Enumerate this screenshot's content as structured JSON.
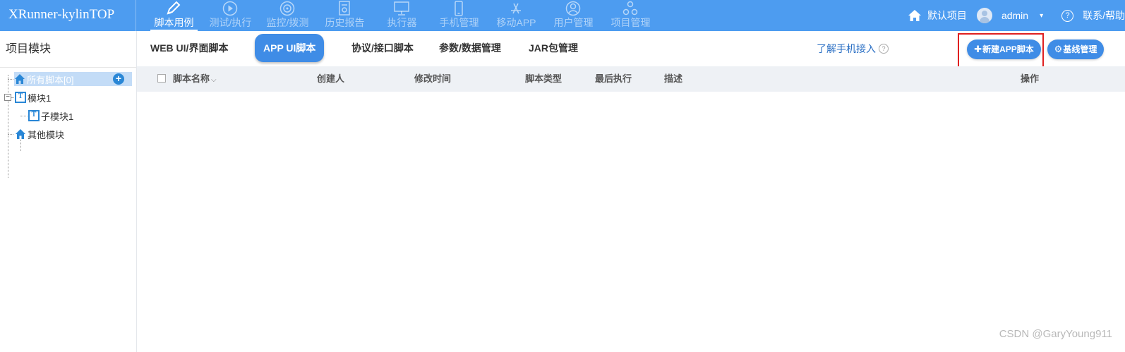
{
  "topbar": {
    "brand": "XRunner-kylinTOP",
    "nav": [
      {
        "label": "脚本用例",
        "icon": "pencil-icon",
        "active": true
      },
      {
        "label": "测试/执行",
        "icon": "play-circle-icon",
        "active": false
      },
      {
        "label": "监控/拨测",
        "icon": "monitor-target-icon",
        "active": false
      },
      {
        "label": "历史报告",
        "icon": "report-icon",
        "active": false
      },
      {
        "label": "执行器",
        "icon": "desktop-icon",
        "active": false
      },
      {
        "label": "手机管理",
        "icon": "mobile-icon",
        "active": false
      },
      {
        "label": "移动APP",
        "icon": "app-store-icon",
        "active": false
      },
      {
        "label": "用户管理",
        "icon": "user-icon",
        "active": false
      },
      {
        "label": "项目管理",
        "icon": "hierarchy-icon",
        "active": false
      }
    ],
    "project": "默认项目",
    "user": "admin",
    "caret": "▾",
    "help_glyph": "?",
    "contact": "联系/帮助"
  },
  "sidebar": {
    "title": "项目模块",
    "tree": [
      {
        "label": "所有脚本[0]",
        "icon": "home-icon",
        "selected": true
      },
      {
        "label": "模块1",
        "icon": "module-t-icon",
        "expander": "−"
      },
      {
        "label": "子模块1",
        "icon": "module-t-icon"
      },
      {
        "label": "其他模块",
        "icon": "home-icon"
      }
    ],
    "add_glyph": "+"
  },
  "main": {
    "tabs": [
      {
        "label": "WEB UI/界面脚本",
        "active": false
      },
      {
        "label": "APP UI脚本",
        "active": true
      },
      {
        "label": "协议/接口脚本",
        "active": false
      },
      {
        "label": "参数/数据管理",
        "active": false
      },
      {
        "label": "JAR包管理",
        "active": false
      }
    ],
    "learn_link": "了解手机接入",
    "learn_glyph": "?",
    "new_button": {
      "icon": "plus-icon",
      "glyph": "✚",
      "label": "新建APP脚本"
    },
    "baseline_button": {
      "icon": "gear-icon",
      "glyph": "⚙",
      "label": "基线管理"
    },
    "columns": [
      "脚本名称",
      "创建人",
      "修改时间",
      "脚本类型",
      "最后执行",
      "描述",
      "操作"
    ],
    "sort_caret": "⌵"
  },
  "watermark": "CSDN @GaryYoung911",
  "colors": {
    "topbar": "#4d9cf0",
    "accent": "#3f8ce6",
    "highlight": "#e02020",
    "selected": "#c3dcf7"
  }
}
